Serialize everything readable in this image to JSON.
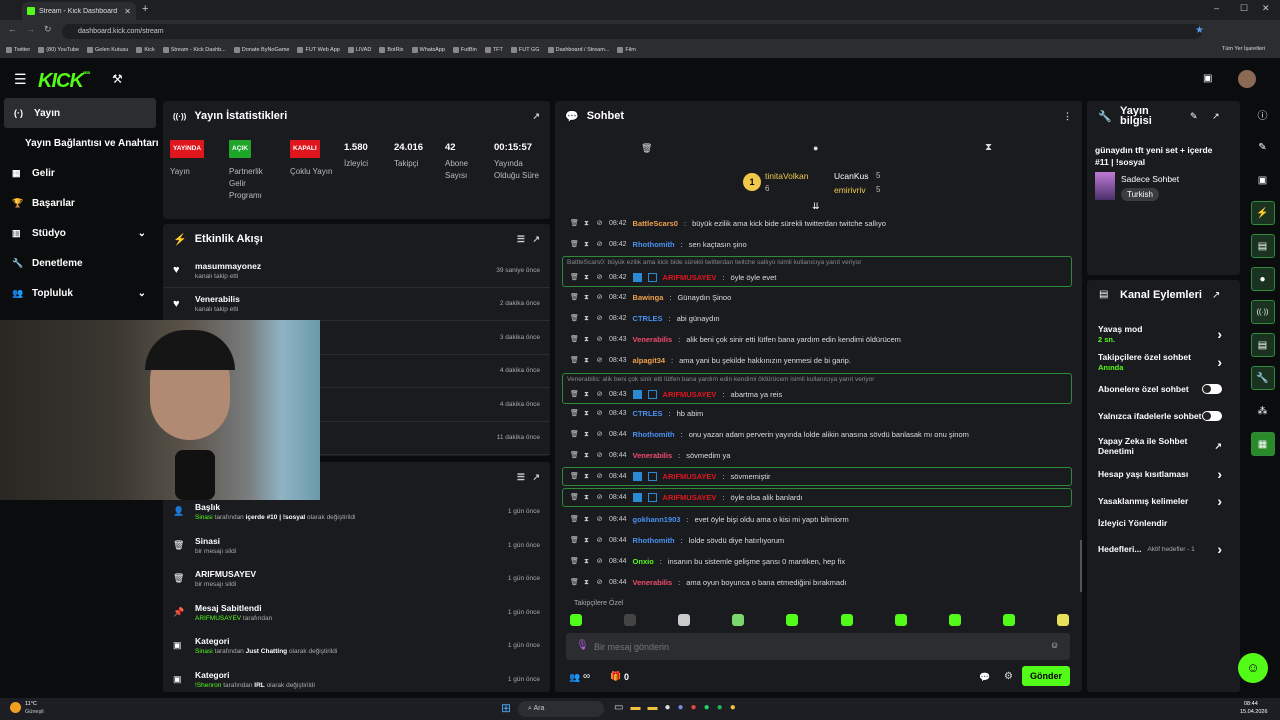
{
  "browser": {
    "tab_title": "Stream - Kick Dashboard",
    "url": "dashboard.kick.com/stream",
    "bookmarks": [
      "Twitter",
      "(80) YouTube",
      "Gelen Kutusu",
      "Kick",
      "Stream - Kick Dashb...",
      "Donate ByNoGame",
      "FUT Web App",
      "LIVAD",
      "BotRix",
      "WhatsApp",
      "FutBin",
      "TFT",
      "FUT GG",
      "Dashboard / Stream...",
      "Film"
    ],
    "all_bookmarks": "Tüm Yer İşaretleri"
  },
  "brand": {
    "logo": "KICK",
    "beta": "BETA",
    "accent": "#53fc18"
  },
  "sidebar": {
    "items": [
      {
        "label": "Yayın",
        "icon": "broadcast-icon"
      },
      {
        "label": "Yayın Bağlantısı ve Anahtarı",
        "icon": ""
      },
      {
        "label": "Gelir",
        "icon": "revenue-icon"
      },
      {
        "label": "Başarılar",
        "icon": "trophy-icon"
      },
      {
        "label": "Stüdyo",
        "icon": "studio-icon"
      },
      {
        "label": "Denetleme",
        "icon": "wrench-icon"
      },
      {
        "label": "Topluluk",
        "icon": "community-icon"
      }
    ]
  },
  "stats": {
    "title": "Yayın İstatistikleri",
    "items": [
      {
        "badge": "YAYINDA",
        "badge_color": "#e0161f",
        "label": "Yayın"
      },
      {
        "badge": "AÇIK",
        "badge_color": "#1ea52a",
        "label": "Partnerlik Gelir Programı"
      },
      {
        "badge": "KAPALI",
        "badge_color": "#e0161f",
        "label": "Çoklu Yayın"
      },
      {
        "value": "1.580",
        "label": "İzleyici"
      },
      {
        "value": "24.016",
        "label": "Takipçi"
      },
      {
        "value": "42",
        "label": "Abone Sayısı"
      },
      {
        "value": "00:15:57",
        "label": "Yayında Olduğu Süre"
      }
    ]
  },
  "activity": {
    "title": "Etkinlik Akışı",
    "rows": [
      {
        "name": "masummayonez",
        "sub": "kanalı takip etti",
        "time": "39 saniye önce"
      },
      {
        "name": "Venerabilis",
        "sub": "kanalı takip etti",
        "time": "2 dakika önce"
      },
      {
        "name": "",
        "sub": "",
        "time": "3 dakika önce"
      },
      {
        "name": "",
        "sub": "",
        "time": "4 dakika önce"
      },
      {
        "name": "",
        "sub": "",
        "time": "4 dakika önce"
      },
      {
        "name": "",
        "sub": "",
        "time": "11 dakika önce"
      }
    ]
  },
  "modlog": {
    "rows": [
      {
        "name": "Başlık",
        "sub_user": "Sinasi",
        "sub_mid": " tarafından ",
        "sub_val": "içerde #10 | !sosyal",
        "sub_end": " olarak değiştirildi",
        "time": "1 gün önce"
      },
      {
        "name": "Sinasi",
        "sub_user": "",
        "sub_mid": "bir mesajı sildi",
        "sub_val": "",
        "sub_end": "",
        "time": "1 gün önce"
      },
      {
        "name": "ARIFMUSAYEV",
        "sub_user": "",
        "sub_mid": "bir mesajı sildi",
        "sub_val": "",
        "sub_end": "",
        "time": "1 gün önce"
      },
      {
        "name": "Mesaj Sabitlendi",
        "sub_user": "ARIFMUSAYEV",
        "sub_mid": " tarafından",
        "sub_val": "",
        "sub_end": "",
        "time": "1 gün önce"
      },
      {
        "name": "Kategori",
        "sub_user": "Sinasi",
        "sub_mid": " tarafından ",
        "sub_val": "Just Chatting",
        "sub_end": " olarak değiştirildi",
        "time": "1 gün önce"
      },
      {
        "name": "Kategori",
        "sub_user": "!Shenron",
        "sub_mid": " tarafından ",
        "sub_val": "IRL",
        "sub_end": " olarak değiştirildi",
        "time": "1 gün önce"
      }
    ]
  },
  "chat": {
    "title": "Sohbet",
    "top_gifters": [
      {
        "rank": "1",
        "name": "tinitaVolkan",
        "count": "6"
      },
      {
        "name": "UcanKus",
        "count": "5"
      },
      {
        "name": "emirivriv",
        "count": "5"
      }
    ],
    "messages": [
      {
        "time": "08:42",
        "user": "BattleScars0",
        "color": "#f0a04b",
        "text": "büyük ezilik ama kick bide sürekli twitterdan twitche sallıyo"
      },
      {
        "time": "08:42",
        "user": "Rhothomith",
        "color": "#4a90f0",
        "text": "sen kaçtasın şino"
      },
      {
        "time": "08:42",
        "user": "ARIFMUSAYEV",
        "color": "#e0161f",
        "text": "öyle öyle evet",
        "reply": "BattleScars0: büyük ezilik ama kick bide sürekli twitterdan twitche sallıyo isimli kullanıcıya yanıt veriyor"
      },
      {
        "time": "08:42",
        "user": "Bawinga",
        "color": "#f0a04b",
        "text": "Günaydın Şinoo"
      },
      {
        "time": "08:42",
        "user": "CTRLES",
        "color": "#4a90f0",
        "text": "abi günaydın"
      },
      {
        "time": "08:43",
        "user": "Venerabilis",
        "color": "#f04b6e",
        "text": "alik beni çok sinir etti lütfen bana yardım edin kendimi öldürücem"
      },
      {
        "time": "08:43",
        "user": "alpagit34",
        "color": "#f0a04b",
        "text": "ama yani bu şekilde hakkınızın yenmesi de bi garip."
      },
      {
        "time": "08:43",
        "user": "ARIFMUSAYEV",
        "color": "#e0161f",
        "text": "abartma ya reis",
        "reply": "Venerabilis: alik beni çok sinir etti lütfen bana yardım edin kendimi öldürücem isimli kullanıcıya yanıt veriyor"
      },
      {
        "time": "08:43",
        "user": "CTRLES",
        "color": "#4a90f0",
        "text": "hb abim"
      },
      {
        "time": "08:44",
        "user": "Rhothomith",
        "color": "#4a90f0",
        "text": "onu yazan adam perverin yayında lolde alikin anasına sövdü banlasak mı onu şinom"
      },
      {
        "time": "08:44",
        "user": "Venerabilis",
        "color": "#f04b6e",
        "text": "sövmedim ya"
      },
      {
        "time": "08:44",
        "user": "ARIFMUSAYEV",
        "color": "#e0161f",
        "text": "sövmemiştir"
      },
      {
        "time": "08:44",
        "user": "ARIFMUSAYEV",
        "color": "#e0161f",
        "text": "öyle olsa alik banlardı"
      },
      {
        "time": "08:44",
        "user": "gokhann1903",
        "color": "#4a90f0",
        "text": "evet öyle bişi oldu ama o kisi mi yaptı bilmiorm"
      },
      {
        "time": "08:44",
        "user": "Rhothomith",
        "color": "#4a90f0",
        "text": "lolde sövdü diye hatırlıyorum"
      },
      {
        "time": "08:44",
        "user": "Onxio",
        "color": "#53fc18",
        "text": "insanın bu sistemle gelişme şansı 0 mantiken, hep fix"
      },
      {
        "time": "08:44",
        "user": "Venerabilis",
        "color": "#f04b6e",
        "text": "ama oyun boyunca o bana etmediğini bırakmadı"
      }
    ],
    "followers_only": "Takipçilere Özel",
    "input_placeholder": "Bir mesaj gönderin",
    "send": "Gönder",
    "viewer_count": "∞",
    "gift_count": "0"
  },
  "stream_info": {
    "title": "Yayın bilgisi",
    "stream_title": "günaydın tft yeni set + içerde #11 | !sosyal",
    "category": "Sadece Sohbet",
    "tag": "Turkish"
  },
  "channel_actions": {
    "title": "Kanal Eylemleri",
    "items": [
      {
        "label": "Yavaş mod",
        "sub": "2 sn.",
        "type": "chev"
      },
      {
        "label": "Takipçilere özel sohbet",
        "sub": "Anında",
        "type": "chev"
      },
      {
        "label": "Abonelere özel sohbet",
        "type": "toggle"
      },
      {
        "label": "Yalnızca ifadelerle sohbet",
        "type": "toggle"
      },
      {
        "label": "Yapay Zeka ile Sohbet Denetimi",
        "type": "ext"
      },
      {
        "label": "Hesap yaşı kısıtlaması",
        "type": "chev"
      },
      {
        "label": "Yasaklanmış kelimeler",
        "type": "chev"
      },
      {
        "label": "İzleyici Yönlendir",
        "type": "none"
      },
      {
        "label": "Hedefleri...",
        "sub": "Aktif hedefler - 1",
        "type": "chev"
      }
    ]
  },
  "taskbar": {
    "weather": "11°C",
    "weather_sub": "Güneşli",
    "search": "Ara",
    "time": "08:44",
    "date": "15.04.2026"
  }
}
